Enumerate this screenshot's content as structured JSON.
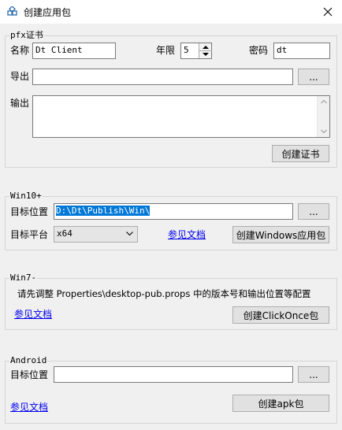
{
  "window": {
    "title": "创建应用包",
    "icon": "package-icon",
    "close_icon": "close-icon"
  },
  "pfx": {
    "legend": "pfx证书",
    "name_label": "名称",
    "name_value": "Dt Client",
    "years_label": "年限",
    "years_value": "5",
    "password_label": "密码",
    "password_value": "dt",
    "export_label": "导出",
    "export_value": "",
    "browse_label": "...",
    "output_label": "输出",
    "output_value": "",
    "create_cert_label": "创建证书"
  },
  "win10": {
    "legend": "Win10+",
    "target_label": "目标位置",
    "target_value": "D:\\Dt\\Publish\\Win\\",
    "browse_label": "...",
    "platform_label": "目标平台",
    "platform_value": "x64",
    "docs_link": "参见文档",
    "create_label": "创建Windows应用包"
  },
  "win7": {
    "legend": "Win7-",
    "hint": "请先调整 Properties\\desktop-pub.props 中的版本号和输出位置等配置",
    "docs_link": "参见文档",
    "create_label": "创建ClickOnce包"
  },
  "android": {
    "legend": "Android",
    "target_label": "目标位置",
    "target_value": "",
    "browse_label": "...",
    "docs_link": "参见文档",
    "create_label": "创建apk包"
  }
}
